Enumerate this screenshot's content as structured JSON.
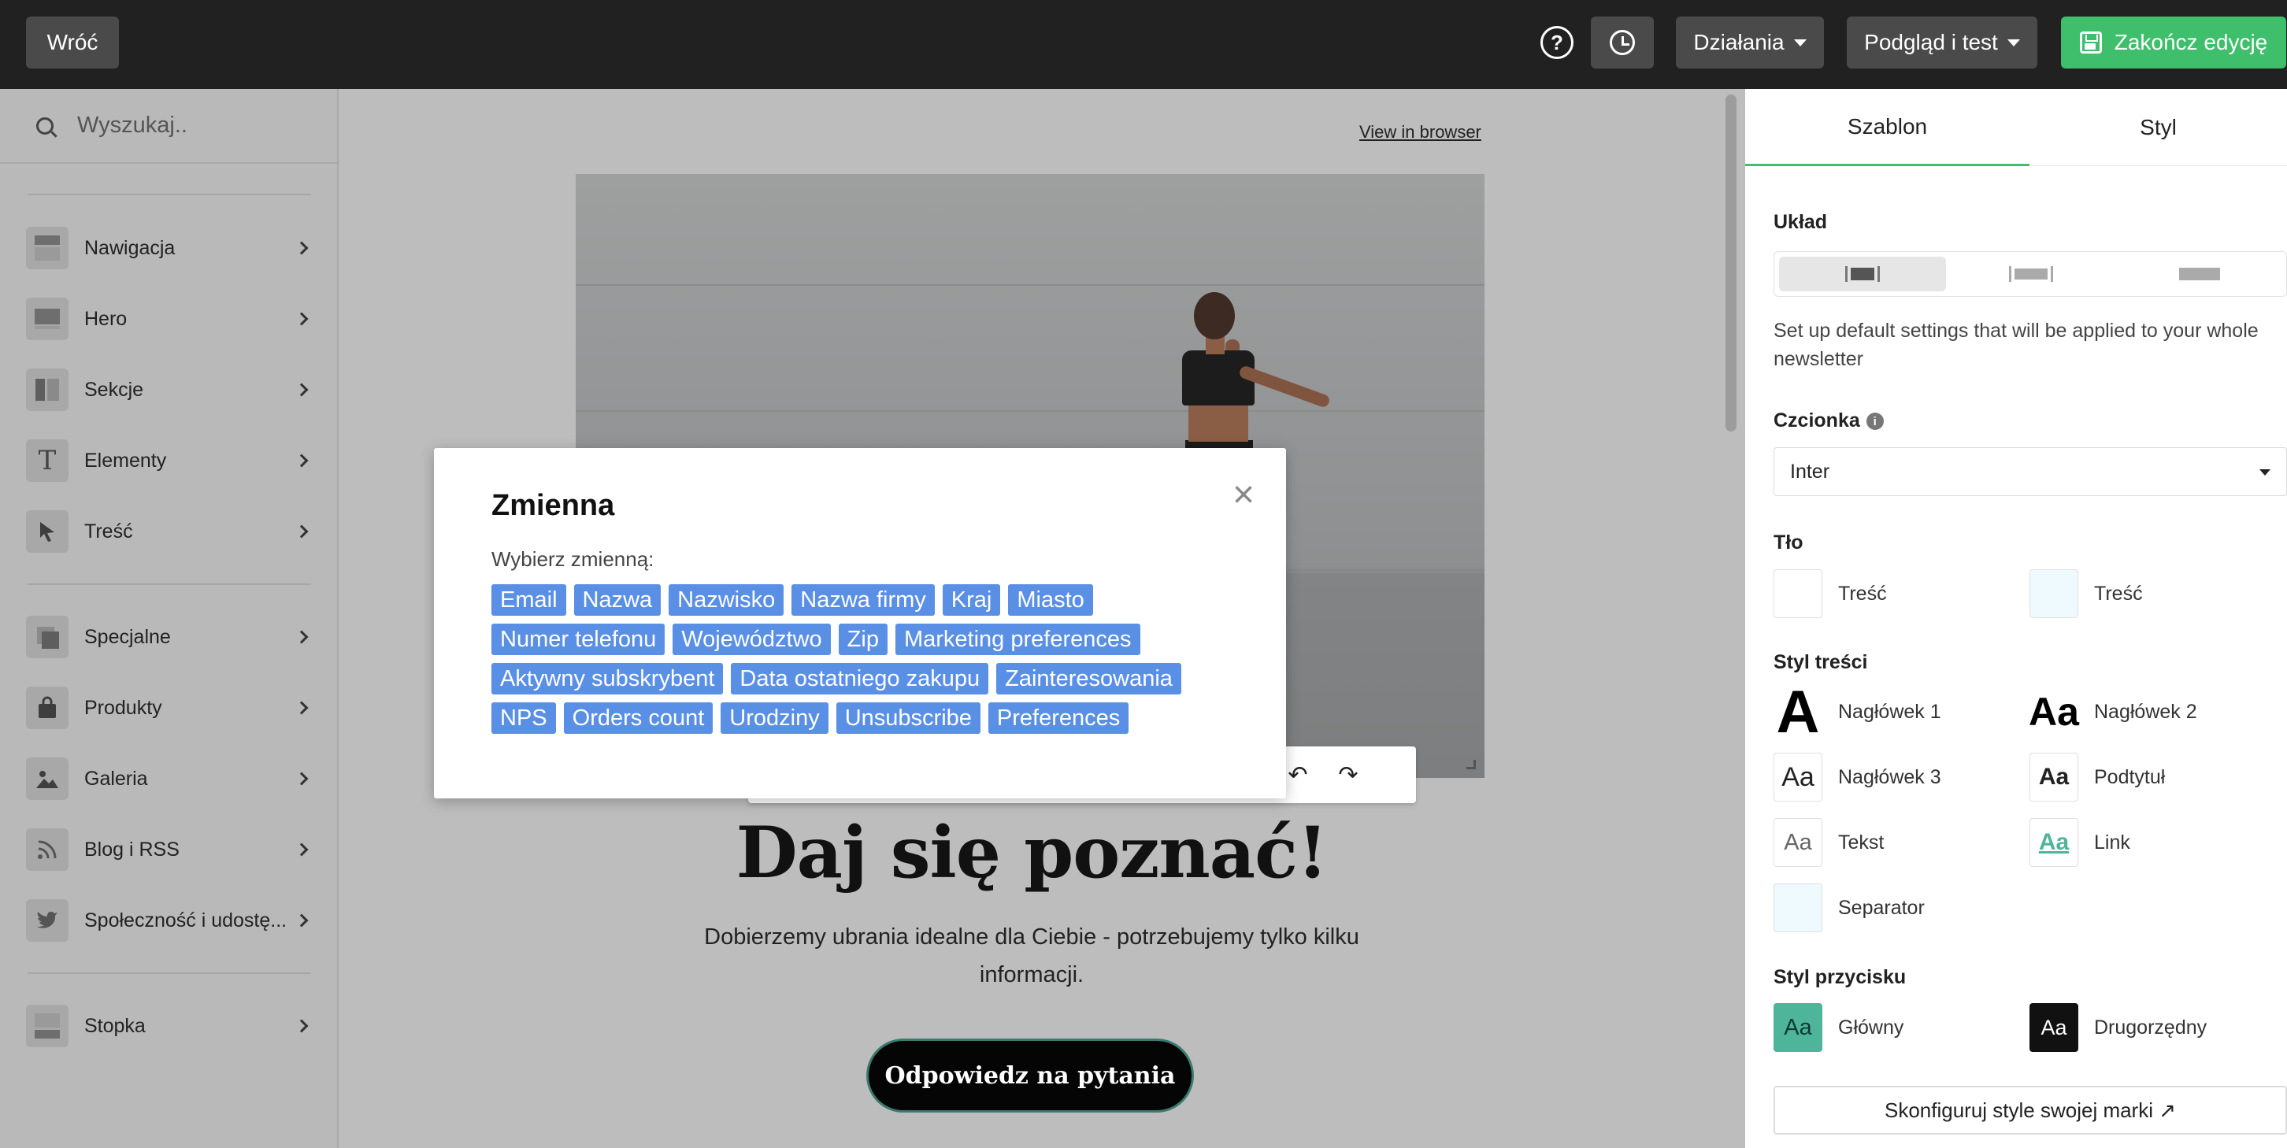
{
  "topbar": {
    "back_label": "Wróć",
    "help_glyph": "?",
    "actions_label": "Działania",
    "preview_label": "Podgląd i test",
    "finish_label": "Zakończ edycję",
    "accent_color": "#3fbf6b"
  },
  "sidebar": {
    "search_placeholder": "Wyszukaj..",
    "groups": [
      [
        {
          "label": "Nawigacja",
          "icon": "layout-top-icon"
        },
        {
          "label": "Hero",
          "icon": "layout-hero-icon"
        },
        {
          "label": "Sekcje",
          "icon": "columns-icon"
        },
        {
          "label": "Elementy",
          "icon": "text-icon"
        },
        {
          "label": "Treść",
          "icon": "cursor-icon"
        }
      ],
      [
        {
          "label": "Specjalne",
          "icon": "stack-icon"
        },
        {
          "label": "Produkty",
          "icon": "bag-icon"
        },
        {
          "label": "Galeria",
          "icon": "image-icon"
        },
        {
          "label": "Blog i RSS",
          "icon": "rss-icon"
        },
        {
          "label": "Społeczność i udostę...",
          "icon": "twitter-icon"
        }
      ],
      [
        {
          "label": "Stopka",
          "icon": "layout-bottom-icon"
        }
      ]
    ]
  },
  "canvas": {
    "view_in_browser": "View in browser",
    "headline": "Daj się poznać!",
    "subline_1": "Dobierzemy ubrania idealne dla Ciebie - potrzebujemy tylko kilku",
    "subline_2": "informacji.",
    "cta_label": "Odpowiedz na pytania"
  },
  "modal": {
    "title": "Zmienna",
    "close_glyph": "×",
    "subtitle": "Wybierz zmienną:",
    "tag_rows": [
      [
        "Email",
        "Nazwa",
        "Nazwisko",
        "Nazwa firmy",
        "Kraj",
        "Miasto"
      ],
      [
        "Numer telefonu",
        "Województwo",
        "Zip",
        "Marketing preferences"
      ],
      [
        "Aktywny subskrybent",
        "Data ostatniego zakupu",
        "Zainteresowania"
      ],
      [
        "NPS",
        "Orders count",
        "Urodziny",
        "Unsubscribe",
        "Preferences"
      ]
    ],
    "tag_color": "#5a8fe6"
  },
  "panel": {
    "tab_template": "Szablon",
    "tab_style": "Styl",
    "layout_heading": "Układ",
    "layout_desc": "Set up default settings that will be applied to your whole newsletter",
    "font_heading": "Czcionka",
    "font_value": "Inter",
    "bg_heading": "Tło",
    "bg_items": [
      {
        "label": "Treść",
        "color": "#ffffff"
      },
      {
        "label": "Treść",
        "color": "#eefafd"
      }
    ],
    "content_style_heading": "Styl treści",
    "content_styles": [
      {
        "sample": "A",
        "label": "Nagłówek 1"
      },
      {
        "sample": "Aa",
        "label": "Nagłówek 2"
      },
      {
        "sample": "Aa",
        "label": "Nagłówek 3"
      },
      {
        "sample": "Aa",
        "label": "Podtytuł"
      },
      {
        "sample": "Aa",
        "label": "Tekst"
      },
      {
        "sample": "Aa",
        "label": "Link"
      },
      {
        "sample": "",
        "label": "Separator"
      }
    ],
    "button_style_heading": "Styl przycisku",
    "button_styles": [
      {
        "sample": "Aa",
        "label": "Główny",
        "color": "#4fb59a"
      },
      {
        "sample": "Aa",
        "label": "Drugorzędny",
        "color": "#111111"
      }
    ],
    "brand_button": "Skonfiguruj style swojej marki ↗"
  }
}
